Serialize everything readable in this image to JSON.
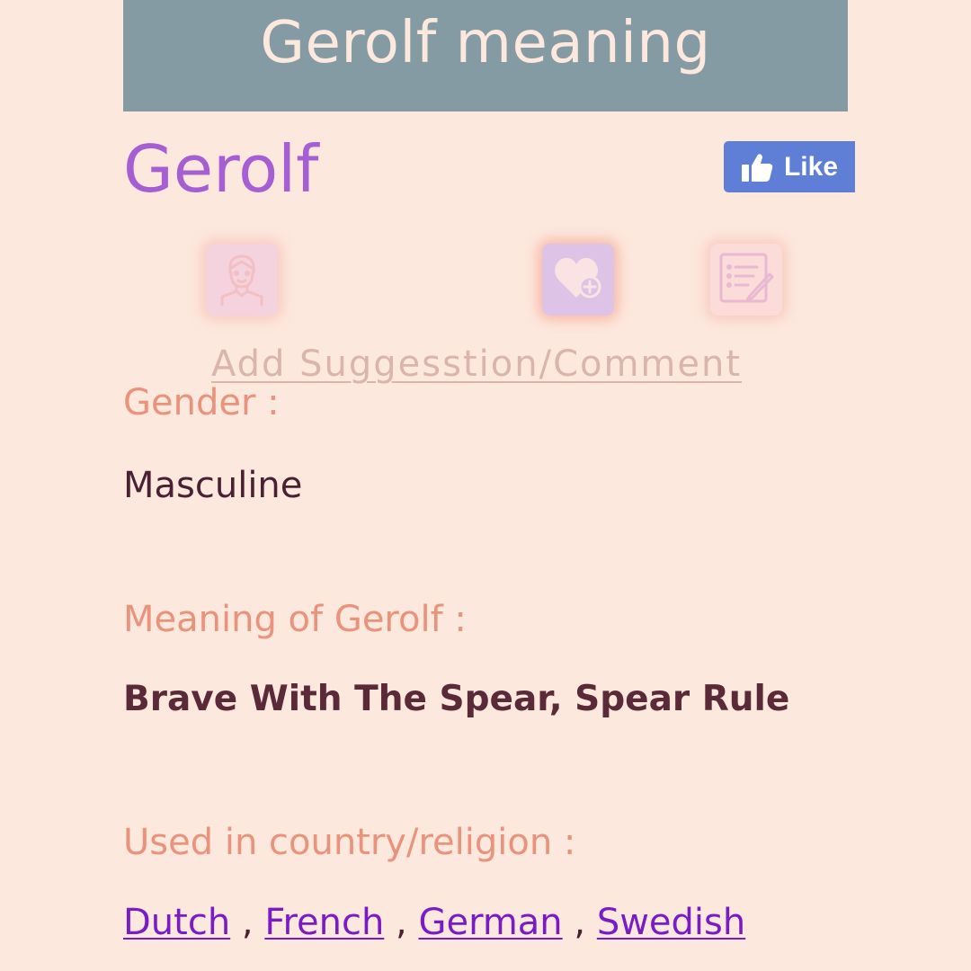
{
  "banner": {
    "title": "Gerolf meaning"
  },
  "name": "Gerolf",
  "like_button": {
    "label": "Like",
    "icon": "thumbs-up-icon",
    "color": "#5f7fd7"
  },
  "actions": {
    "icons": [
      "avatar-icon",
      "heart-plus-icon",
      "edit-note-icon"
    ],
    "suggestion_link": "Add Suggesstion/Comment"
  },
  "fields": {
    "gender_label": "Gender :",
    "gender_value": "Masculine",
    "meaning_label": "Meaning of Gerolf :",
    "meaning_value": "Brave With The Spear,  Spear Rule",
    "countries_label": "Used in country/religion :",
    "countries": [
      "Dutch",
      "French",
      "German",
      "Swedish"
    ],
    "separator": " , "
  },
  "colors": {
    "background": "#fde8de",
    "banner": "#849ba4",
    "name": "#a55fd3",
    "label": "#e9927c",
    "link": "#7a1cc4"
  }
}
